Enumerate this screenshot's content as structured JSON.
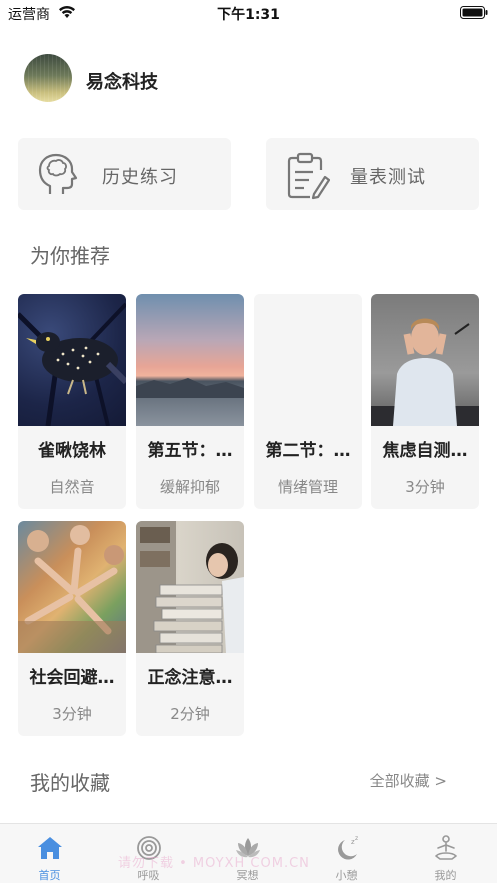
{
  "status_bar": {
    "carrier": "运营商",
    "time": "下午1:31"
  },
  "profile": {
    "name": "易念科技"
  },
  "features": [
    {
      "label": "历史练习",
      "icon": "head-profile-icon"
    },
    {
      "label": "量表测试",
      "icon": "clipboard-edit-icon"
    }
  ],
  "recommend": {
    "title": "为你推荐",
    "items": [
      {
        "title": "雀啾饶林",
        "subtitle": "自然音"
      },
      {
        "title": "第五节：…",
        "subtitle": "缓解抑郁"
      },
      {
        "title": "第二节：…",
        "subtitle": "情绪管理"
      },
      {
        "title": "焦虑自测…",
        "subtitle": "3分钟"
      },
      {
        "title": "社会回避…",
        "subtitle": "3分钟"
      },
      {
        "title": "正念注意…",
        "subtitle": "2分钟"
      }
    ]
  },
  "favorites": {
    "title": "我的收藏",
    "all_label": "全部收藏 >"
  },
  "tabs": [
    {
      "label": "首页",
      "icon": "home-icon",
      "active": true
    },
    {
      "label": "呼吸",
      "icon": "breath-target-icon"
    },
    {
      "label": "冥想",
      "icon": "lotus-icon"
    },
    {
      "label": "小憩",
      "icon": "moon-sleep-icon"
    },
    {
      "label": "我的",
      "icon": "meditation-person-icon"
    }
  ],
  "watermark": "请勿下载 • MOYXH COM.CN",
  "colors": {
    "accent": "#4a8fe0",
    "card_bg": "#f5f5f5",
    "muted_text": "#888888"
  }
}
